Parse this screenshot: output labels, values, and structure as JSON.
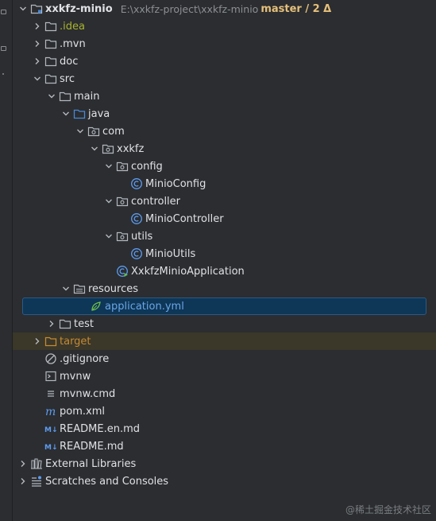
{
  "project": {
    "name": "xxkfz-minio",
    "path": "E:\\xxkfz-project\\xxkfz-minio",
    "branch": "master / 2 Δ"
  },
  "tree": {
    "idea": ".idea",
    "mvn": ".mvn",
    "doc": "doc",
    "src": "src",
    "main": "main",
    "java": "java",
    "com": "com",
    "xxkfz": "xxkfz",
    "config": "config",
    "minio_config": "MinioConfig",
    "controller": "controller",
    "minio_controller": "MinioController",
    "utils": "utils",
    "minio_utils": "MinioUtils",
    "application_class": "XxkfzMinioApplication",
    "resources": "resources",
    "application_yml": "application.yml",
    "test": "test",
    "target": "target",
    "gitignore": ".gitignore",
    "mvnw": "mvnw",
    "mvnw_cmd": "mvnw.cmd",
    "pom": "pom.xml",
    "readme_en": "README.en.md",
    "readme": "README.md",
    "external_libraries": "External Libraries",
    "scratches": "Scratches and Consoles"
  },
  "watermark": "@稀土掘金技术社区",
  "icons": {
    "folder": "folder-icon",
    "package": "package-icon",
    "class": "class-icon",
    "yaml": "yaml-file-icon",
    "markdown": "markdown-icon",
    "maven": "maven-icon",
    "terminal": "terminal-icon",
    "ignore": "gitignore-icon",
    "libraries": "libraries-icon",
    "scratches": "scratches-icon"
  },
  "colors": {
    "background": "#2b2d30",
    "selection": "#0e3657",
    "excluded_row": "#3b3729",
    "class_icon": "#5e9cf1",
    "target_folder": "#c48a33",
    "branch": "#e5c07b"
  }
}
